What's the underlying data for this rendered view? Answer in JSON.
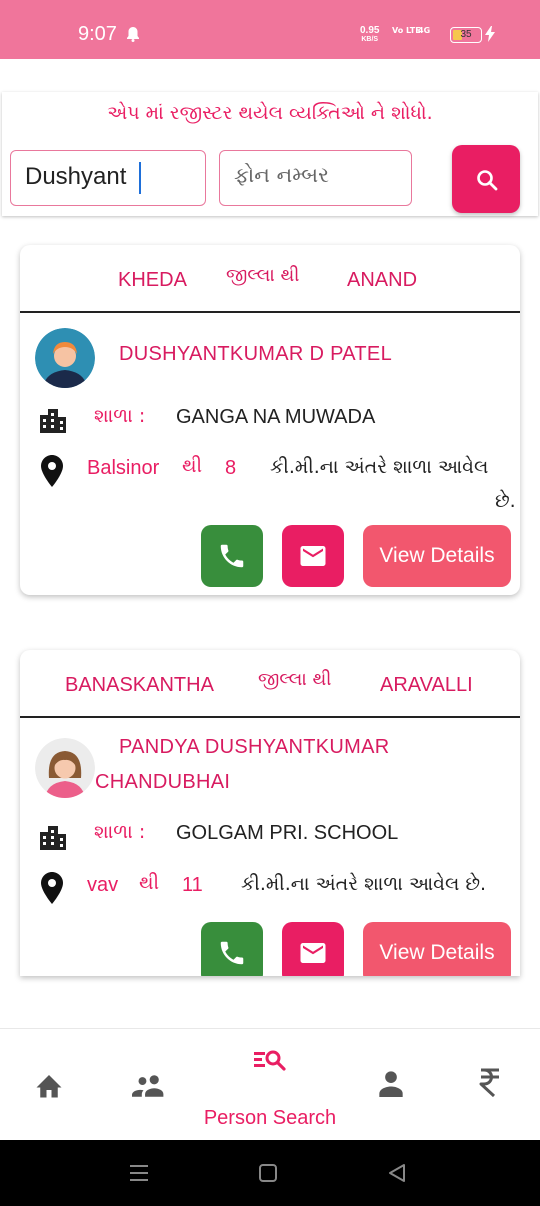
{
  "status": {
    "time": "9:07",
    "net_speed": "0.95",
    "net_unit": "KB/S",
    "sig1": "Vo\nLTE",
    "sig2": "4G",
    "battery": "35"
  },
  "search": {
    "caption": "એપ માં રજીસ્ટર થયેલ વ્યક્તિઓ ને શોધો.",
    "name_value": "Dushyant",
    "phone_placeholder": "ફોન નમ્બર"
  },
  "results": [
    {
      "district_from": "KHEDA",
      "connector": "જીલ્લા થી",
      "district_to": "ANAND",
      "name": "DUSHYANTKUMAR D PATEL",
      "school_label": "શાળા :",
      "school": "GANGA NA MUWADA",
      "place": "Balsinor",
      "from_word": "થી",
      "distance": "8",
      "distance_text_1": "કી.મી.ના અંતરે શાળા આવેલ",
      "distance_text_2": "છે.",
      "view_label": "View Details"
    },
    {
      "district_from": "BANASKANTHA",
      "connector": "જીલ્લા થી",
      "district_to": "ARAVALLI",
      "name_line1": "PANDYA DUSHYANTKUMAR",
      "name_line2": "CHANDUBHAI",
      "school_label": "શાળા :",
      "school": "GOLGAM PRI. SCHOOL",
      "place": "vav",
      "from_word": "થી",
      "distance": "11",
      "distance_text": "કી.મી.ના અંતરે શાળા આવેલ છે.",
      "view_label": "View Details"
    }
  ],
  "bottom_nav": {
    "active_label": "Person Search"
  },
  "colors": {
    "accent": "#e91e63",
    "status_bar": "#f0759b",
    "call_green": "#388e3c",
    "view_button": "#f2576e"
  }
}
